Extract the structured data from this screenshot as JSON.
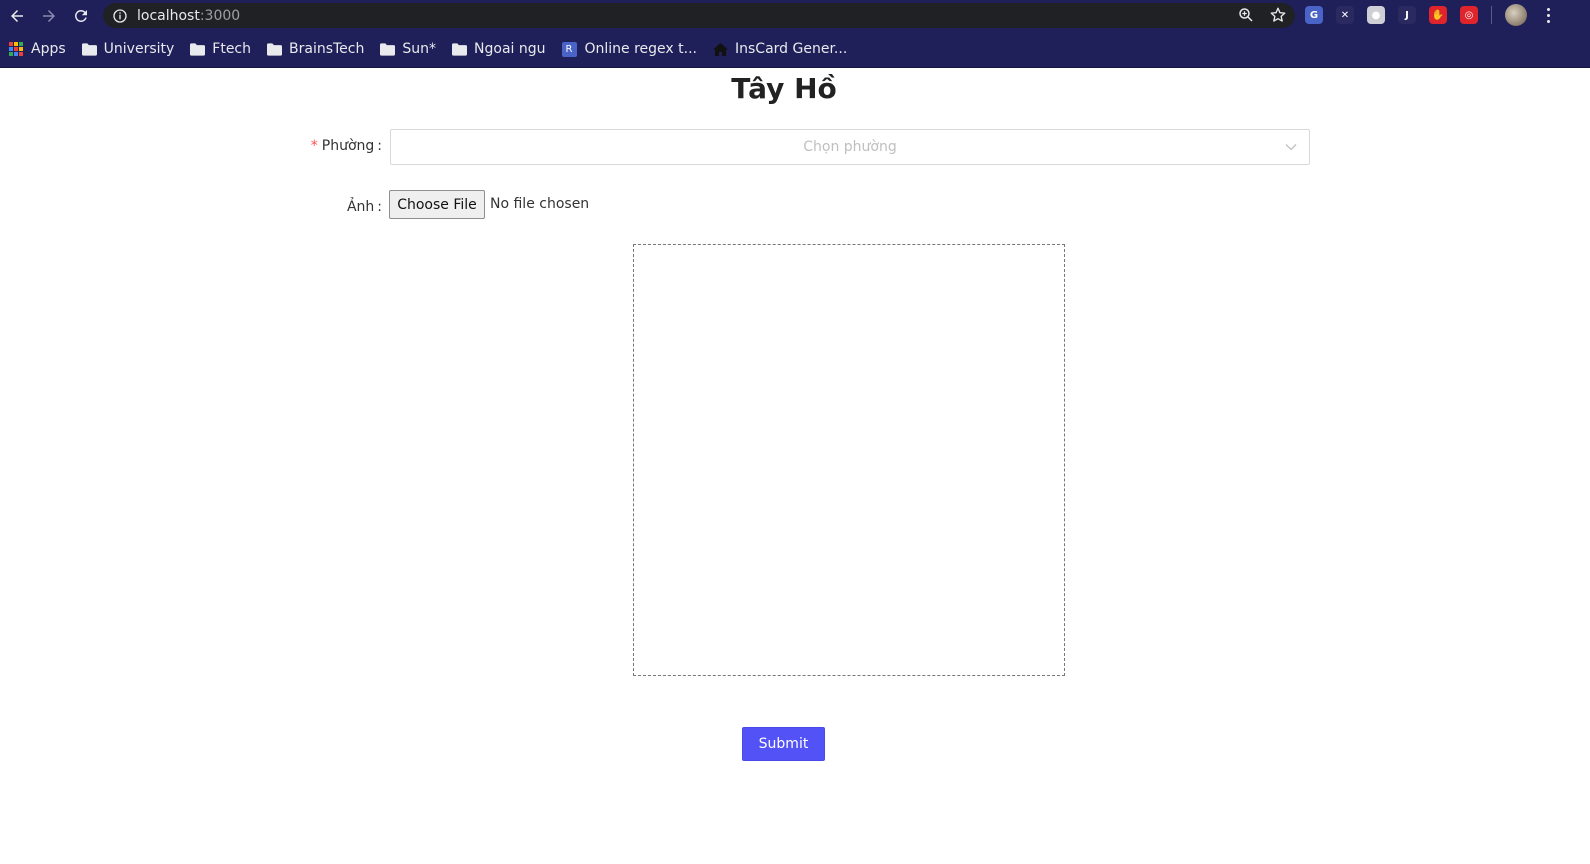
{
  "browser": {
    "url_host": "localhost",
    "url_port": ":3000",
    "bookmarks": [
      {
        "label": "Apps",
        "icon": "apps-grid-icon"
      },
      {
        "label": "University",
        "icon": "folder-icon"
      },
      {
        "label": "Ftech",
        "icon": "folder-icon"
      },
      {
        "label": "BrainsTech",
        "icon": "folder-icon"
      },
      {
        "label": "Sun*",
        "icon": "folder-icon"
      },
      {
        "label": "Ngoai ngu",
        "icon": "folder-icon"
      },
      {
        "label": "Online regex t...",
        "icon": "regex-r-icon",
        "badge": "R"
      },
      {
        "label": "InsCard Gener...",
        "icon": "home-icon"
      }
    ],
    "extensions": [
      {
        "name": "translate-extension-icon",
        "glyph": "G",
        "color": "#4a63c7"
      },
      {
        "name": "x-extension-icon",
        "glyph": "✕",
        "color": "#2a2a60"
      },
      {
        "name": "ghost-extension-icon",
        "glyph": "●",
        "color": "#cfcfd6"
      },
      {
        "name": "j-extension-icon",
        "glyph": "J",
        "color": "#2a2a60"
      },
      {
        "name": "red-hand-extension-icon",
        "glyph": "✋",
        "color": "#e0242c"
      },
      {
        "name": "shield-extension-icon",
        "glyph": "◎",
        "color": "#e0242c"
      }
    ]
  },
  "form": {
    "title": "Tây Hồ",
    "ward_required_mark": "*",
    "ward_label": "Phường",
    "ward_placeholder": "Chọn phường",
    "image_label": "Ảnh",
    "label_colon": ":",
    "file_button_label": "Choose File",
    "file_status": "No file chosen",
    "submit_label": "Submit"
  },
  "colors": {
    "chrome_bg": "#1f1f5a",
    "submit_bg": "#5252f7",
    "required": "#ff4d4f"
  }
}
